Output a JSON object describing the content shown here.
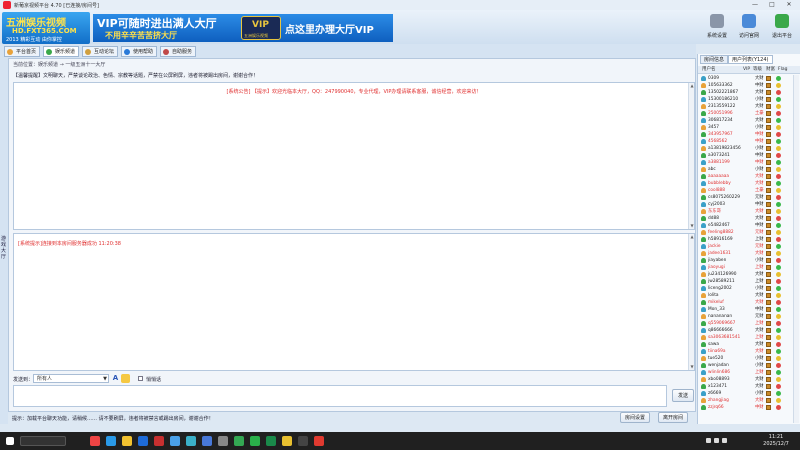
{
  "window": {
    "title": "新葡京视频平台 4.70 [已连接/房间号]",
    "controls": [
      "—",
      "□",
      "✕"
    ]
  },
  "logo": {
    "line1": "五洲娱乐视频",
    "line2": "HD.FXT365.COM",
    "line3": "2013 精彩互动 由你掌控"
  },
  "banner": {
    "line1": "VIP可随时进出满人大厅",
    "line2": "不用辛辛苦苦挤大厅",
    "vip_emblem": "VIP",
    "vip_sub": "五洲娱乐视频",
    "line3": "点这里办理大厅VIP"
  },
  "header_buttons": [
    {
      "label": "系统设置",
      "icon": "gear-icon"
    },
    {
      "label": "访问官网",
      "icon": "home-icon"
    },
    {
      "label": "退出平台",
      "icon": "exit-icon"
    }
  ],
  "tabs": [
    {
      "label": "平台首页",
      "icon": "home-icon",
      "color": "#e8a23a"
    },
    {
      "label": "娱乐频道",
      "icon": "channel-icon",
      "color": "#3aa84a"
    },
    {
      "label": "互动论坛",
      "icon": "forum-icon",
      "color": "#d0a040"
    },
    {
      "label": "使用帮助",
      "icon": "help-icon",
      "color": "#2a7ad8"
    },
    {
      "label": "自助服务",
      "icon": "service-icon",
      "color": "#c04848"
    }
  ],
  "side_tab": {
    "label": "游戏大厅"
  },
  "room": {
    "breadcrumb": "当前位置：娱乐频道 → 一级五洲十一大厅",
    "notice": "【温馨提醒】文明聊天，严禁谈论政治、色情、宗教等话题，严禁在公屏刷屏，违者将被踢出房间，谢谢合作！",
    "public_system_msg": "[系统公告] 【提示】欢迎光临本大厅，QQ：247990040，专业代理，VIP办理请联系客服，诚信经营，欢迎来访！",
    "private_system_msg": "[系统提示]连接到本房间服务器成功  11:20:38"
  },
  "send": {
    "label": "发送到：",
    "target": "所有人",
    "font_icon": "A",
    "quiet_label": "悄悄话",
    "send_button": "发送"
  },
  "hint": {
    "text": "提示：加载平台聊天功能，请稍候……  请不要刷屏，违者将被禁言或踢出房间，谢谢合作！",
    "settings_button": "房间设置",
    "exit_button": "离开房间"
  },
  "user_panel": {
    "tabs": [
      "房间信息",
      "用户列表(Y124)"
    ],
    "columns": [
      "用户名",
      "VIP",
      "等级",
      "财富",
      "Flag"
    ],
    "users": [
      {
        "name": "0309",
        "level": "大财",
        "color": "#222"
      },
      {
        "name": "105633362",
        "level": "中财",
        "color": "#222"
      },
      {
        "name": "13502221867",
        "level": "大财",
        "color": "#222"
      },
      {
        "name": "15300186210",
        "level": "小财",
        "color": "#222"
      },
      {
        "name": "2313559122",
        "level": "大财",
        "color": "#222"
      },
      {
        "name": "250051996",
        "level": "土豪",
        "color": "#e03030"
      },
      {
        "name": "306817234",
        "level": "大财",
        "color": "#222"
      },
      {
        "name": "3457",
        "level": "小财",
        "color": "#222"
      },
      {
        "name": "343957967",
        "level": "中财",
        "color": "#e03030"
      },
      {
        "name": "4568562",
        "level": "中财",
        "color": "#e03030"
      },
      {
        "name": "a13819823456",
        "level": "小财",
        "color": "#222"
      },
      {
        "name": "a3073241",
        "level": "中财",
        "color": "#222"
      },
      {
        "name": "a3881199",
        "level": "中财",
        "color": "#e03030"
      },
      {
        "name": "abc",
        "level": "小财",
        "color": "#222"
      },
      {
        "name": "aaaaaaaa",
        "level": "大财",
        "color": "#e03030"
      },
      {
        "name": "bubblebby",
        "level": "大财",
        "color": "#e03030"
      },
      {
        "name": "cool888",
        "level": "土豪",
        "color": "#e03030"
      },
      {
        "name": "cs8075260229",
        "level": "元财",
        "color": "#222"
      },
      {
        "name": "cyj2003",
        "level": "中财",
        "color": "#222"
      },
      {
        "name": "东东哥",
        "level": "大财",
        "color": "#e03030"
      },
      {
        "name": "dd88",
        "level": "大财",
        "color": "#222"
      },
      {
        "name": "e5482467",
        "level": "中财",
        "color": "#222"
      },
      {
        "name": "feeling8882",
        "level": "元财",
        "color": "#e03030"
      },
      {
        "name": "h58916169",
        "level": "上财",
        "color": "#222"
      },
      {
        "name": "jackie",
        "level": "元财",
        "color": "#e03030"
      },
      {
        "name": "jadee1631",
        "level": "大财",
        "color": "#e03030"
      },
      {
        "name": "jiayaben",
        "level": "小财",
        "color": "#222"
      },
      {
        "name": "jiaoyugi",
        "level": "上财",
        "color": "#e03030"
      },
      {
        "name": "ju234126990",
        "level": "大财",
        "color": "#222"
      },
      {
        "name": "jw28589211",
        "level": "上财",
        "color": "#222"
      },
      {
        "name": "liceng2002",
        "level": "小财",
        "color": "#222"
      },
      {
        "name": "lolita",
        "level": "大财",
        "color": "#222"
      },
      {
        "name": "mikeluf",
        "level": "大财",
        "color": "#e03030"
      },
      {
        "name": "Mon_33",
        "level": "中财",
        "color": "#222"
      },
      {
        "name": "nanananan",
        "level": "元财",
        "color": "#222"
      },
      {
        "name": "q559069667",
        "level": "上财",
        "color": "#e03030"
      },
      {
        "name": "q86666666",
        "level": "大财",
        "color": "#222"
      },
      {
        "name": "sa3063681541",
        "level": "上财",
        "color": "#e03030"
      },
      {
        "name": "sawa",
        "level": "大财",
        "color": "#222"
      },
      {
        "name": "tiina69a",
        "level": "大财",
        "color": "#e03030"
      },
      {
        "name": "tue520",
        "level": "小财",
        "color": "#222"
      },
      {
        "name": "wenjadan",
        "level": "小财",
        "color": "#222"
      },
      {
        "name": "wlinlin686",
        "level": "上财",
        "color": "#e03030"
      },
      {
        "name": "xbo08893",
        "level": "大财",
        "color": "#222"
      },
      {
        "name": "x123471",
        "level": "大财",
        "color": "#222"
      },
      {
        "name": "z6669",
        "level": "小财",
        "color": "#222"
      },
      {
        "name": "zhangjiag",
        "level": "大财",
        "color": "#e03030"
      },
      {
        "name": "zzjrq66",
        "level": "中财",
        "color": "#e03030"
      }
    ]
  },
  "taskbar": {
    "time": "11:21",
    "date": "2025/12/7"
  }
}
